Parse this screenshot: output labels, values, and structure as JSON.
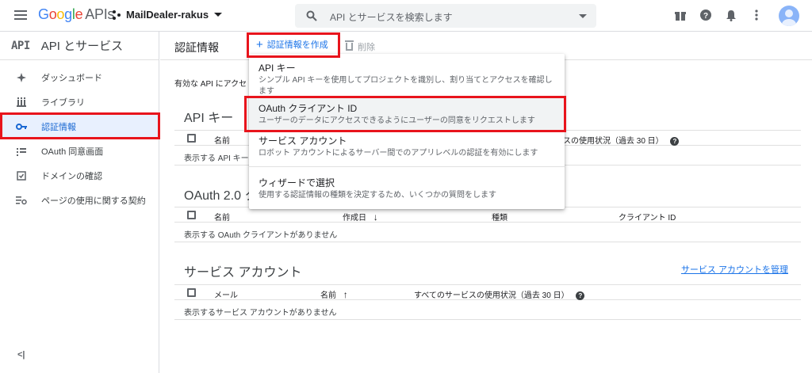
{
  "topbar": {
    "logo_google": [
      "G",
      "o",
      "o",
      "g",
      "l",
      "e"
    ],
    "logo_apis": "APIs",
    "project_name": "MailDealer-rakus",
    "search_placeholder": "API とサービスを検索します"
  },
  "sidebar": {
    "api_logo": "API",
    "title": "API とサービス",
    "items": [
      {
        "label": "ダッシュボード",
        "icon": "dashboard-icon"
      },
      {
        "label": "ライブラリ",
        "icon": "library-icon"
      },
      {
        "label": "認証情報",
        "icon": "key-icon"
      },
      {
        "label": "OAuth 同意画面",
        "icon": "consent-icon"
      },
      {
        "label": "ドメインの確認",
        "icon": "domain-check-icon"
      },
      {
        "label": "ページの使用に関する契約",
        "icon": "settings-list-icon"
      }
    ],
    "collapse": "<|"
  },
  "action_bar": {
    "title": "認証情報",
    "create_label": "認証情報を作成",
    "delete_label": "削除"
  },
  "main": {
    "intro": "有効な API にアクセ",
    "api_keys": {
      "title": "API キー",
      "col_name": "名前",
      "col_usage": "スの使用状況（過去 30 日）",
      "empty": "表示する API キー"
    },
    "oauth": {
      "title": "OAuth 2.0 ク",
      "col_name": "名前",
      "col_created": "作成日",
      "col_type": "種類",
      "col_client_id": "クライアント ID",
      "empty": "表示する OAuth クライアントがありません"
    },
    "service_accounts": {
      "title": "サービス アカウント",
      "manage_link": "サービス アカウントを管理",
      "col_mail": "メール",
      "col_name": "名前",
      "col_usage": "すべてのサービスの使用状況（過去 30 日）",
      "empty": "表示するサービス アカウントがありません"
    }
  },
  "menu": {
    "items": [
      {
        "title": "API キー",
        "desc": "シンプル API キーを使用してプロジェクトを識別し、割り当てとアクセスを確認します"
      },
      {
        "title": "OAuth クライアント ID",
        "desc": "ユーザーのデータにアクセスできるようにユーザーの同意をリクエストします"
      },
      {
        "title": "サービス アカウント",
        "desc": "ロボット アカウントによるサーバー間でのアプリレベルの認証を有効にします"
      },
      {
        "title": "ウィザードで選択",
        "desc": "使用する認証情報の種類を決定するため、いくつかの質問をします"
      }
    ]
  },
  "colors": {
    "accent": "#1a73e8",
    "highlight_box": "#e8141c",
    "active_bg": "#e8f0fe"
  }
}
